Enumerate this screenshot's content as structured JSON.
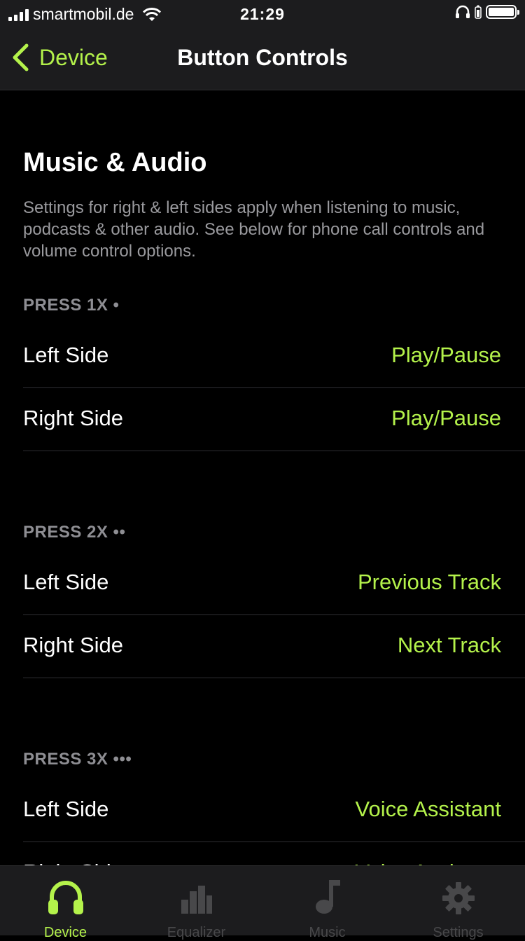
{
  "status_bar": {
    "carrier": "smartmobil.de",
    "time": "21:29"
  },
  "nav": {
    "back_label": "Device",
    "title": "Button Controls"
  },
  "section": {
    "title": "Music & Audio",
    "description": "Settings for right & left sides apply when listening to music, podcasts & other audio. See below for phone call controls and volume control options."
  },
  "groups": [
    {
      "header": "PRESS 1X •",
      "rows": [
        {
          "label": "Left Side",
          "value": "Play/Pause"
        },
        {
          "label": "Right Side",
          "value": "Play/Pause"
        }
      ]
    },
    {
      "header": "PRESS 2X ••",
      "rows": [
        {
          "label": "Left Side",
          "value": "Previous Track"
        },
        {
          "label": "Right Side",
          "value": "Next Track"
        }
      ]
    },
    {
      "header": "PRESS 3X •••",
      "rows": [
        {
          "label": "Left Side",
          "value": "Voice Assistant"
        },
        {
          "label": "Right Side",
          "value": "Voice Assistant"
        }
      ]
    }
  ],
  "tabs": [
    {
      "label": "Device",
      "icon": "headphones-icon",
      "active": true
    },
    {
      "label": "Equalizer",
      "icon": "equalizer-icon",
      "active": false
    },
    {
      "label": "Music",
      "icon": "music-note-icon",
      "active": false
    },
    {
      "label": "Settings",
      "icon": "gear-icon",
      "active": false
    }
  ],
  "colors": {
    "accent": "#b4f24b",
    "background": "#000000",
    "bar": "#1c1c1e"
  }
}
